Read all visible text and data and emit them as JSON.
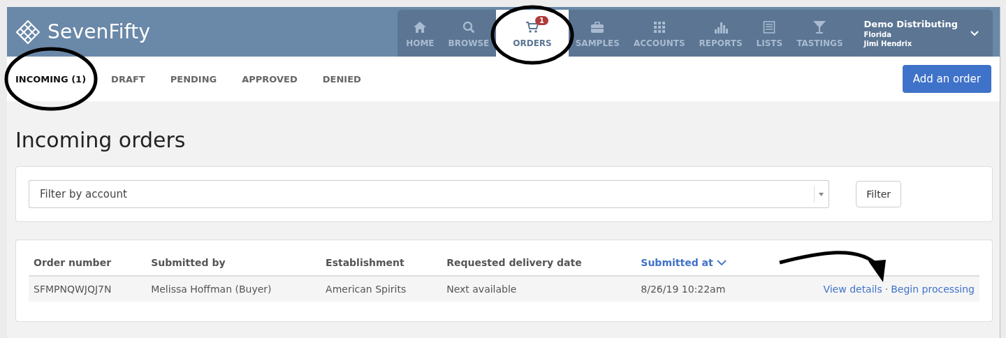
{
  "brand": "SevenFifty",
  "nav": [
    {
      "label": "HOME",
      "kind": "home",
      "selected": false
    },
    {
      "label": "BROWSE",
      "kind": "search",
      "selected": false
    },
    {
      "label": "ORDERS",
      "kind": "cart",
      "selected": true,
      "badge": "1"
    },
    {
      "label": "SAMPLES",
      "kind": "briefcase",
      "selected": false
    },
    {
      "label": "ACCOUNTS",
      "kind": "grid",
      "selected": false
    },
    {
      "label": "REPORTS",
      "kind": "bars",
      "selected": false
    },
    {
      "label": "LISTS",
      "kind": "list",
      "selected": false
    },
    {
      "label": "TASTINGS",
      "kind": "glass",
      "selected": false
    }
  ],
  "account": {
    "company": "Demo Distributing",
    "region": "Florida",
    "user": "Jimi Hendrix"
  },
  "tabs": [
    {
      "label": "INCOMING (1)",
      "selected": true
    },
    {
      "label": "DRAFT",
      "selected": false
    },
    {
      "label": "PENDING",
      "selected": false
    },
    {
      "label": "APPROVED",
      "selected": false
    },
    {
      "label": "DENIED",
      "selected": false
    }
  ],
  "add_button": "Add an order",
  "title": "Incoming orders",
  "filter": {
    "placeholder": "Filter by account",
    "button": "Filter"
  },
  "table": {
    "columns": [
      {
        "label": "Order number",
        "sorted": false
      },
      {
        "label": "Submitted by",
        "sorted": false
      },
      {
        "label": "Establishment",
        "sorted": false
      },
      {
        "label": "Requested delivery date",
        "sorted": false
      },
      {
        "label": "Submitted at",
        "sorted": true
      }
    ],
    "rows": [
      {
        "cells": [
          "SFMPNQWJQJ7N",
          "Melissa Hoffman (Buyer)",
          "American Spirits",
          "Next available",
          "8/26/19 10:22am"
        ],
        "actions": [
          "View details",
          "Begin processing"
        ],
        "separator": "·"
      }
    ]
  }
}
